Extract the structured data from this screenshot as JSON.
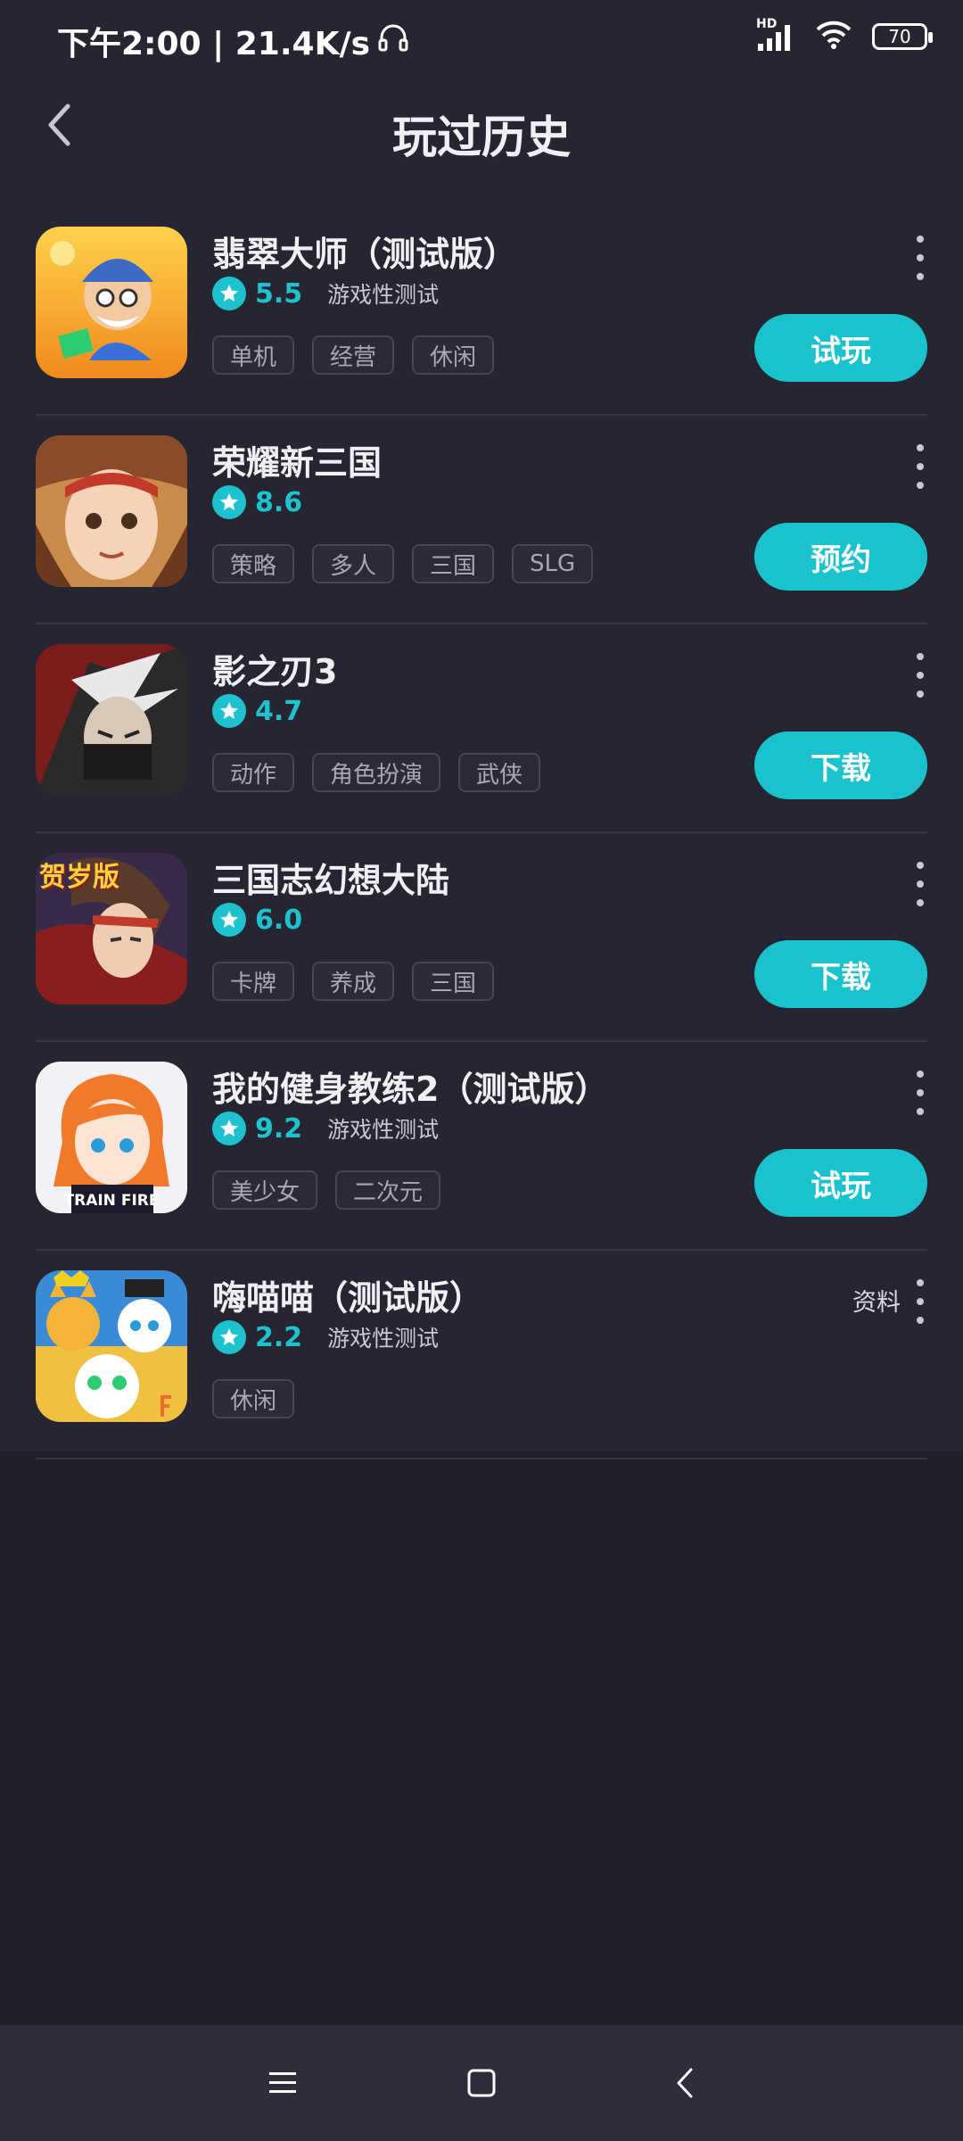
{
  "status_bar": {
    "time_speed": "下午2:00 | 21.4K/s",
    "network": "HD",
    "battery": "70"
  },
  "header": {
    "title": "玩过历史"
  },
  "games": [
    {
      "name": "翡翠大师（测试版）",
      "score": "5.5",
      "test_label": "游戏性测试",
      "tags": [
        "单机",
        "经营",
        "休闲"
      ],
      "action": "试玩",
      "info": ""
    },
    {
      "name": "荣耀新三国",
      "score": "8.6",
      "test_label": "",
      "tags": [
        "策略",
        "多人",
        "三国",
        "SLG"
      ],
      "action": "预约",
      "info": ""
    },
    {
      "name": "影之刃3",
      "score": "4.7",
      "test_label": "",
      "tags": [
        "动作",
        "角色扮演",
        "武侠"
      ],
      "action": "下载",
      "info": ""
    },
    {
      "name": "三国志幻想大陆",
      "score": "6.0",
      "test_label": "",
      "tags": [
        "卡牌",
        "养成",
        "三国"
      ],
      "action": "下载",
      "info": "",
      "icon_text": "贺岁版"
    },
    {
      "name": "我的健身教练2（测试版）",
      "score": "9.2",
      "test_label": "游戏性测试",
      "tags": [
        "美少女",
        "二次元"
      ],
      "action": "试玩",
      "info": "",
      "icon_text": "TRAIN FIRE"
    },
    {
      "name": "嗨喵喵（测试版）",
      "score": "2.2",
      "test_label": "游戏性测试",
      "tags": [
        "休闲"
      ],
      "action": "",
      "info": "资料"
    }
  ]
}
